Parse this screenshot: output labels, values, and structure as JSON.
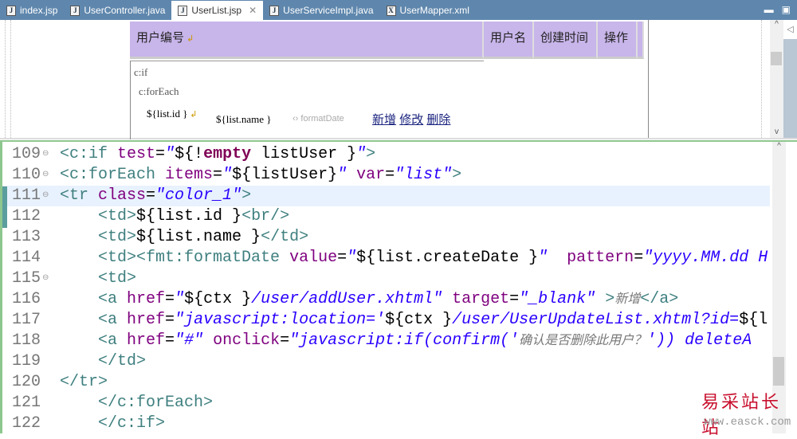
{
  "tabs": [
    {
      "label": "index.jsp",
      "icon": "J"
    },
    {
      "label": "UserController.java",
      "icon": "J"
    },
    {
      "label": "UserList.jsp",
      "icon": "J",
      "active": true
    },
    {
      "label": "UserServiceImpl.java",
      "icon": "J"
    },
    {
      "label": "UserMapper.xml",
      "icon": "X"
    }
  ],
  "close_glyph": "✕",
  "design": {
    "headers": [
      "用户编号",
      "用户名",
      "创建时间",
      "操作"
    ],
    "cif": "c:if",
    "foreach": "c:forEach",
    "cell_id": "${list.id }",
    "cell_name": "${list.name }",
    "cell_date": "formatDate",
    "links": [
      "新增",
      "修改",
      "删除"
    ]
  },
  "code_lines": [
    {
      "n": "109",
      "fold": true,
      "tokens": [
        [
          "t",
          "<c:if "
        ],
        [
          "a",
          "test"
        ],
        [
          "x",
          "="
        ],
        [
          "v",
          "\""
        ],
        [
          "e",
          "${!"
        ],
        [
          "k",
          "empty"
        ],
        [
          "e",
          " listUser }"
        ],
        [
          "v",
          "\""
        ],
        [
          "t",
          ">"
        ]
      ]
    },
    {
      "n": "110",
      "fold": true,
      "tokens": [
        [
          "t",
          "<c:forEach "
        ],
        [
          "a",
          "items"
        ],
        [
          "x",
          "="
        ],
        [
          "v",
          "\""
        ],
        [
          "e",
          "${listUser}"
        ],
        [
          "v",
          "\" "
        ],
        [
          "a",
          "var"
        ],
        [
          "x",
          "="
        ],
        [
          "v",
          "\"list\""
        ],
        [
          "t",
          ">"
        ]
      ]
    },
    {
      "n": "111",
      "fold": true,
      "cur": true,
      "tokens": [
        [
          "t",
          "<tr "
        ],
        [
          "a",
          "class"
        ],
        [
          "x",
          "="
        ],
        [
          "v",
          "\"color_1\""
        ],
        [
          "t",
          ">"
        ]
      ]
    },
    {
      "n": "112",
      "tokens": [
        [
          "x",
          "    "
        ],
        [
          "t",
          "<td>"
        ],
        [
          "e",
          "${list.id }"
        ],
        [
          "t",
          "<br/>"
        ]
      ]
    },
    {
      "n": "113",
      "tokens": [
        [
          "x",
          "    "
        ],
        [
          "t",
          "<td>"
        ],
        [
          "e",
          "${list.name }"
        ],
        [
          "t",
          "</td>"
        ]
      ]
    },
    {
      "n": "114",
      "tokens": [
        [
          "x",
          "    "
        ],
        [
          "t",
          "<td><fmt:formatDate "
        ],
        [
          "a",
          "value"
        ],
        [
          "x",
          "="
        ],
        [
          "v",
          "\""
        ],
        [
          "e",
          "${list.createDate }"
        ],
        [
          "v",
          "\"  "
        ],
        [
          "a",
          "pattern"
        ],
        [
          "x",
          "="
        ],
        [
          "v",
          "\"yyyy.MM.dd H"
        ]
      ]
    },
    {
      "n": "115",
      "fold": true,
      "tokens": [
        [
          "x",
          "    "
        ],
        [
          "t",
          "<td>"
        ]
      ]
    },
    {
      "n": "116",
      "tokens": [
        [
          "x",
          "    "
        ],
        [
          "t",
          "<a "
        ],
        [
          "a",
          "href"
        ],
        [
          "x",
          "="
        ],
        [
          "v",
          "\""
        ],
        [
          "e",
          "${ctx }"
        ],
        [
          "v",
          "/user/addUser.xhtml\" "
        ],
        [
          "a",
          "target"
        ],
        [
          "x",
          "="
        ],
        [
          "v",
          "\"_blank\" "
        ],
        [
          "t",
          ">"
        ],
        [
          "c",
          "新增"
        ],
        [
          "t",
          "</a>"
        ]
      ]
    },
    {
      "n": "117",
      "tokens": [
        [
          "x",
          "    "
        ],
        [
          "t",
          "<a "
        ],
        [
          "a",
          "href"
        ],
        [
          "x",
          "="
        ],
        [
          "v",
          "\"javascript:location='"
        ],
        [
          "e",
          "${ctx }"
        ],
        [
          "v",
          "/user/UserUpdateList.xhtml?id="
        ],
        [
          "e",
          "${l"
        ]
      ]
    },
    {
      "n": "118",
      "tokens": [
        [
          "x",
          "    "
        ],
        [
          "t",
          "<a "
        ],
        [
          "a",
          "href"
        ],
        [
          "x",
          "="
        ],
        [
          "v",
          "\"#\" "
        ],
        [
          "a",
          "onclick"
        ],
        [
          "x",
          "="
        ],
        [
          "v",
          "\"javascript:if(confirm('"
        ],
        [
          "c",
          "确认是否删除此用户？"
        ],
        [
          "v",
          "')) deleteA"
        ]
      ]
    },
    {
      "n": "119",
      "tokens": [
        [
          "x",
          "    "
        ],
        [
          "t",
          "</td>"
        ]
      ]
    },
    {
      "n": "120",
      "tokens": [
        [
          "t",
          "</tr>"
        ]
      ]
    },
    {
      "n": "121",
      "tokens": [
        [
          "x",
          "    "
        ],
        [
          "t",
          "</c:forEach>"
        ]
      ]
    },
    {
      "n": "122",
      "tokens": [
        [
          "x",
          "    "
        ],
        [
          "t",
          "</c:if>"
        ]
      ]
    }
  ],
  "watermark": {
    "title": "易采站长站",
    "url": "www.easck.com"
  }
}
